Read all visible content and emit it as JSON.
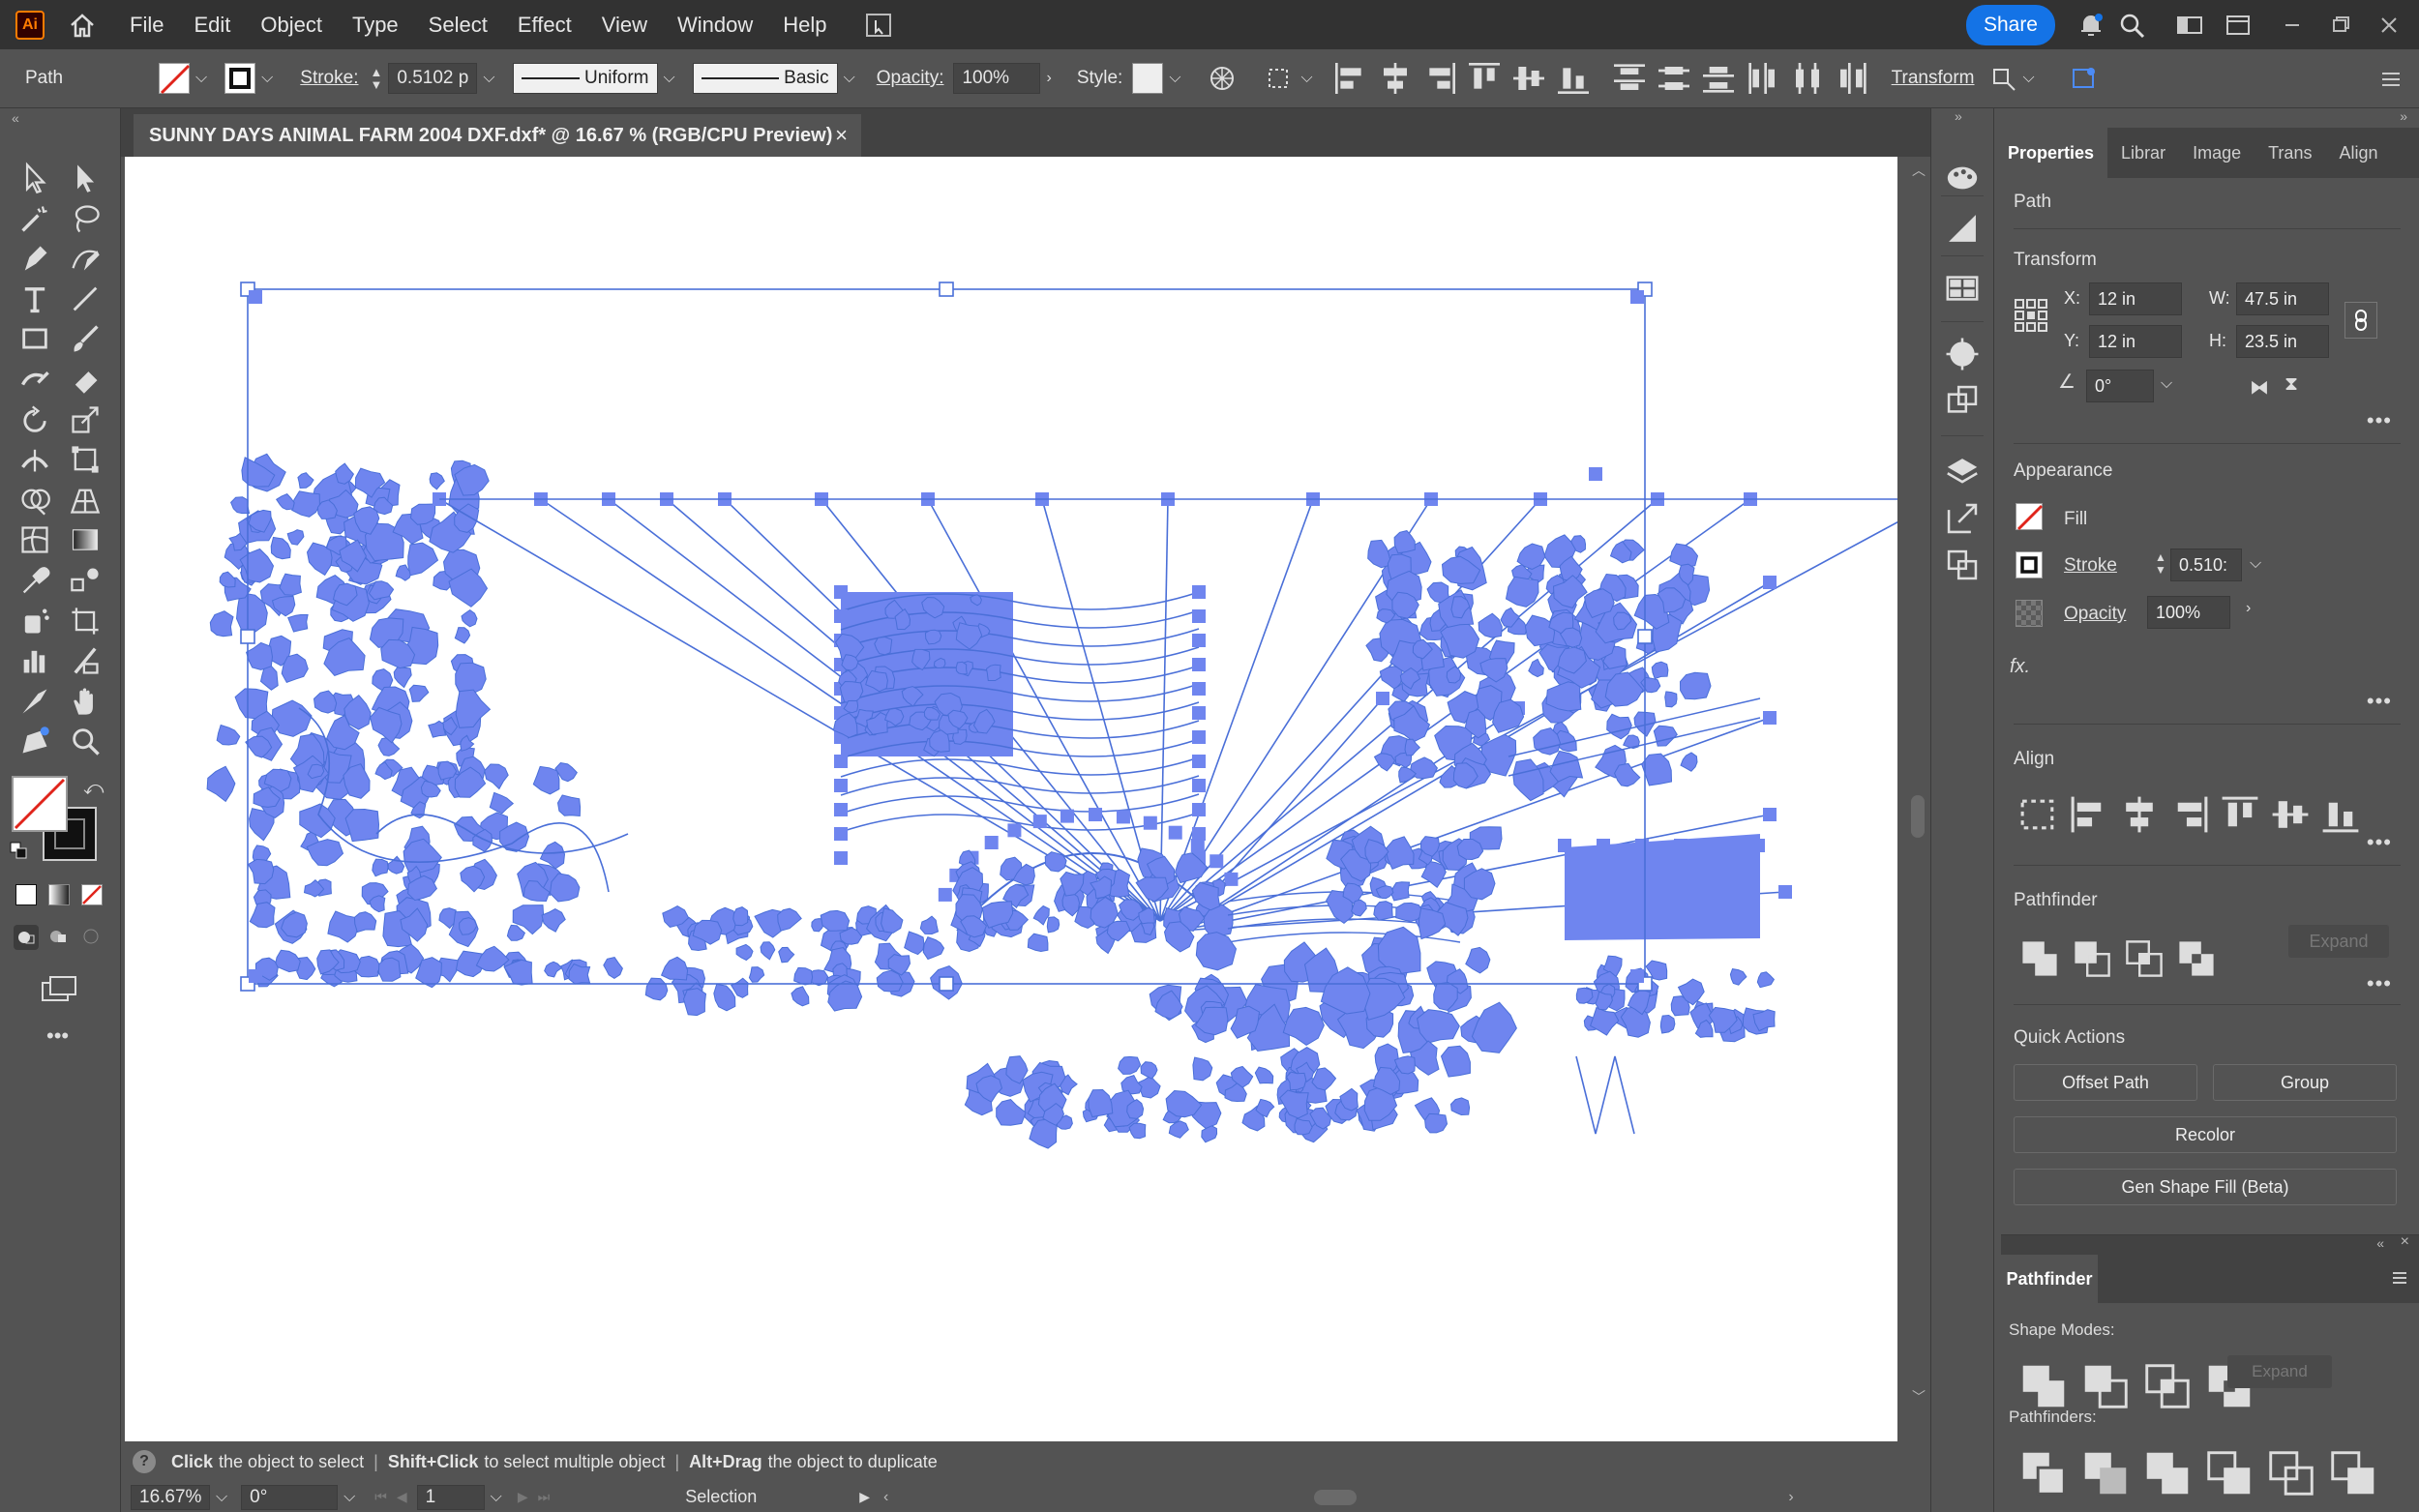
{
  "app": {
    "logo": "Ai"
  },
  "menu": [
    "File",
    "Edit",
    "Object",
    "Type",
    "Select",
    "Effect",
    "View",
    "Window",
    "Help"
  ],
  "share_label": "Share",
  "control": {
    "selection_type": "Path",
    "stroke_label": "Stroke:",
    "stroke_value": "0.5102 p",
    "profile_label": "Uniform",
    "brush_label": "Basic",
    "opacity_label": "Opacity:",
    "opacity_value": "100%",
    "style_label": "Style:",
    "transform_label": "Transform"
  },
  "document": {
    "tab_title": "SUNNY DAYS ANIMAL FARM 2004 DXF.dxf* @ 16.67 % (RGB/CPU Preview)"
  },
  "status": {
    "zoom": "16.67%",
    "rotation": "0°",
    "artboard": "1",
    "tool_mode": "Selection",
    "hint_click_bold": "Click",
    "hint_click": "the object to select",
    "hint_shift_bold": "Shift+Click",
    "hint_shift": "to select multiple object",
    "hint_alt_bold": "Alt+Drag",
    "hint_alt": "the object to duplicate"
  },
  "panel": {
    "tabs": [
      "Properties",
      "Librar",
      "Image",
      "Trans",
      "Align"
    ],
    "selection": "Path",
    "transform": {
      "title": "Transform",
      "x_label": "X:",
      "x": "12 in",
      "y_label": "Y:",
      "y": "12 in",
      "w_label": "W:",
      "w": "47.5 in",
      "h_label": "H:",
      "h": "23.5 in",
      "angle": "0°"
    },
    "appearance": {
      "title": "Appearance",
      "fill": "Fill",
      "stroke": "Stroke",
      "stroke_value": "0.510:",
      "opacity": "Opacity",
      "opacity_value": "100%",
      "fx": "fx."
    },
    "align_title": "Align",
    "pathfinder_title": "Pathfinder",
    "expand": "Expand",
    "quick_actions": {
      "title": "Quick Actions",
      "offset_path": "Offset Path",
      "group": "Group",
      "recolor": "Recolor",
      "gen_shape_fill": "Gen Shape Fill (Beta)"
    }
  },
  "pathfinder_panel": {
    "title": "Pathfinder",
    "shape_modes": "Shape Modes:",
    "expand": "Expand",
    "pathfinders": "Pathfinders:"
  },
  "colors": {
    "accent": "#1473e6",
    "selection": "#4a6fd8",
    "shape_fill": "#6f85ef",
    "logo_orange": "#ff7c00"
  }
}
